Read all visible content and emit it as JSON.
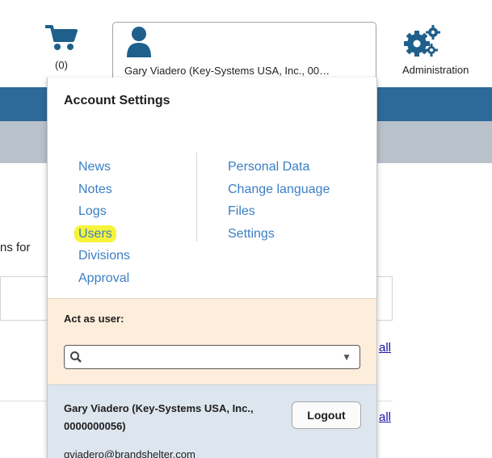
{
  "header": {
    "cart_count": "(0)",
    "user_button_label": "Gary Viadero (Key-Systems USA, Inc., 00…",
    "admin_label": "Administration"
  },
  "background": {
    "partial_text": "ns for",
    "link1": "all",
    "link2": "all"
  },
  "dropdown": {
    "title": "Account Settings",
    "left_links": [
      "News",
      "Notes",
      "Logs",
      "Users",
      "Divisions",
      "Approval"
    ],
    "right_links": [
      "Personal Data",
      "Change language",
      "Files",
      "Settings"
    ],
    "highlighted": "Users",
    "act_as_user_label": "Act as user:",
    "act_as_user_value": "",
    "user_full_name": "Gary Viadero (Key-Systems USA, Inc., 0000000056)",
    "logout_label": "Logout",
    "user_email": "gviadero@brandshelter.com"
  },
  "colors": {
    "bluebar": "#2e6a99",
    "icon_blue": "#1f5f8b",
    "link": "#3b7fc4",
    "highlight": "#f6f43a",
    "act_bg": "#fdeedb",
    "user_bg": "#dde5ee"
  },
  "icons": [
    "cart-icon",
    "user-icon",
    "gears-icon",
    "search-icon",
    "caret-down-icon"
  ]
}
